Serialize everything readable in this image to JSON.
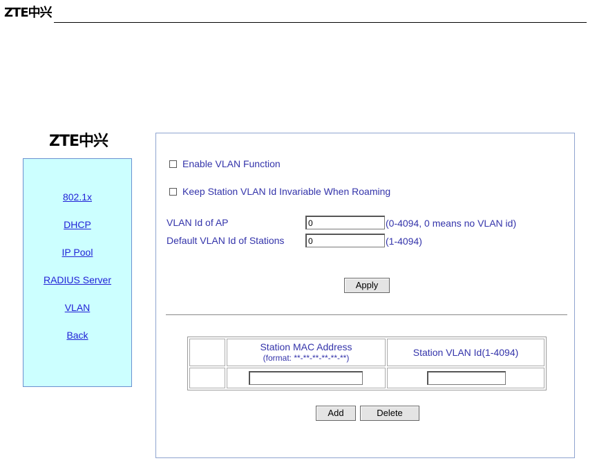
{
  "header": {
    "logo": "ZTE中兴"
  },
  "sidebar": {
    "logo": "ZTE中兴",
    "items": [
      {
        "label": "802.1x"
      },
      {
        "label": "DHCP"
      },
      {
        "label": "IP Pool"
      },
      {
        "label": "RADIUS Server"
      },
      {
        "label": "VLAN"
      },
      {
        "label": "Back"
      }
    ]
  },
  "form": {
    "enable_vlan_label": "Enable VLAN Function",
    "keep_vlan_label": "Keep Station VLAN Id Invariable When Roaming",
    "vlan_ap_label": "VLAN Id of AP",
    "vlan_ap_value": "0",
    "vlan_ap_hint": "(0-4094, 0 means no VLAN id)",
    "default_vlan_label": "Default VLAN Id of Stations",
    "default_vlan_value": "0",
    "default_vlan_hint": "(1-4094)",
    "apply_label": "Apply"
  },
  "table": {
    "col_mac": "Station MAC Address",
    "col_mac_format": "(format: **-**-**-**-**-**)",
    "col_vlan": "Station VLAN Id(1-4094)",
    "mac_value": "",
    "vlan_value": ""
  },
  "actions": {
    "add_label": "Add",
    "delete_label": "Delete"
  }
}
